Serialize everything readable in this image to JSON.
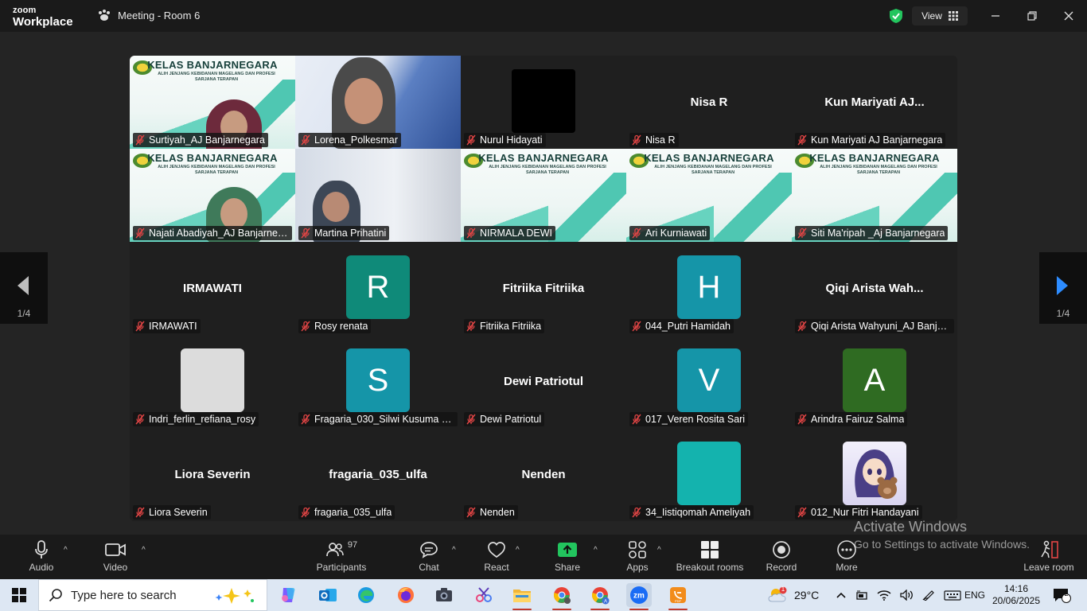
{
  "app": {
    "brand_small": "zoom",
    "brand_big": "Workplace",
    "meeting_title": "Meeting - Room 6",
    "view_label": "View"
  },
  "tiles": [
    {
      "label": "Surtiyah_AJ Banjarnegara",
      "kind": "banner",
      "banner_title": "KELAS BANJARNEGARA",
      "banner_sub": "ALIH JENJANG KEBIDANAN MAGELANG DAN PROFESI SARJANA TERAPAN"
    },
    {
      "label": "Lorena_Polkesmar",
      "kind": "video"
    },
    {
      "label": "Nurul Hidayati",
      "kind": "black"
    },
    {
      "label": "Nisa R",
      "kind": "name",
      "display": "Nisa R"
    },
    {
      "label": "Kun Mariyati AJ Banjarnegara",
      "kind": "name",
      "display": "Kun  Mariyati AJ..."
    },
    {
      "label": "Najati Abadiyah_AJ Banjarneg...",
      "kind": "banner",
      "banner_title": "KELAS BANJARNEGARA",
      "banner_sub": "ALIH JENJANG KEBIDANAN MAGELANG DAN PROFESI SARJANA TERAPAN"
    },
    {
      "label": "Martina Prihatini",
      "kind": "video2"
    },
    {
      "label": "NIRMALA DEWI",
      "kind": "banner",
      "banner_title": "KELAS BANJARNEGARA",
      "banner_sub": "ALIH JENJANG KEBIDANAN MAGELANG DAN PROFESI SARJANA TERAPAN"
    },
    {
      "label": "Ari Kurniawati",
      "kind": "banner",
      "banner_title": "KELAS BANJARNEGARA",
      "banner_sub": "ALIH JENJANG KEBIDANAN MAGELANG DAN PROFESI SARJANA TERAPAN"
    },
    {
      "label": "Siti Ma'ripah _Aj Banjarnegara",
      "kind": "banner",
      "banner_title": "KELAS BANJARNEGARA",
      "banner_sub": "ALIH JENJANG KEBIDANAN MAGELANG DAN PROFESI SARJANA TERAPAN"
    },
    {
      "label": "IRMAWATI",
      "kind": "name",
      "display": "IRMAWATI"
    },
    {
      "label": "Rosy renata",
      "kind": "avatar",
      "letter": "R",
      "color": "#0f8a79"
    },
    {
      "label": "Fitriika Fitriika",
      "kind": "name",
      "display": "Fitriika Fitriika"
    },
    {
      "label": "044_Putri Hamidah",
      "kind": "avatar",
      "letter": "H",
      "color": "#1595a8"
    },
    {
      "label": "Qiqi Arista Wahyuni_AJ Banjar...",
      "kind": "name",
      "display": "Qiqi  Arista  Wah..."
    },
    {
      "label": "Indri_ferlin_refiana_rosy",
      "kind": "avatar",
      "letter": "",
      "color": "#dcdcdc"
    },
    {
      "label": "Fragaria_030_Silwi Kusuma Ju...",
      "kind": "avatar",
      "letter": "S",
      "color": "#1595a8"
    },
    {
      "label": "Dewi Patriotul",
      "kind": "name",
      "display": "Dewi Patriotul"
    },
    {
      "label": "017_Veren Rosita Sari",
      "kind": "avatar",
      "letter": "V",
      "color": "#1595a8"
    },
    {
      "label": "Arindra Fairuz Salma",
      "kind": "avatar",
      "letter": "A",
      "color": "#2f6b22"
    },
    {
      "label": "Liora Severin",
      "kind": "name",
      "display": "Liora Severin"
    },
    {
      "label": "fragaria_035_ulfa",
      "kind": "name",
      "display": "fragaria_035_ulfa"
    },
    {
      "label": "Nenden",
      "kind": "name",
      "display": "Nenden"
    },
    {
      "label": "34_Iistiqomah Ameliyah",
      "kind": "avatar",
      "letter": "",
      "color": "#14b3ae"
    },
    {
      "label": "012_Nur Fitri Handayani",
      "kind": "anime"
    }
  ],
  "pager": {
    "left": "1/4",
    "right": "1/4"
  },
  "toolbar": {
    "audio": "Audio",
    "video": "Video",
    "participants": "Participants",
    "participants_count": "97",
    "chat": "Chat",
    "react": "React",
    "share": "Share",
    "apps": "Apps",
    "breakout": "Breakout rooms",
    "record": "Record",
    "more": "More",
    "leave": "Leave room"
  },
  "watermark": {
    "line1": "Activate Windows",
    "line2": "Go to Settings to activate Windows."
  },
  "taskbar": {
    "search_placeholder": "Type here to search",
    "weather": "29°C",
    "weather_badge": "1",
    "lang": "ENG",
    "time": "14:16",
    "date": "20/06/2025",
    "notif_count": "2"
  },
  "colors": {
    "accent_green": "#23d959",
    "mute_red": "#e34545",
    "share_green": "#22c55e"
  }
}
